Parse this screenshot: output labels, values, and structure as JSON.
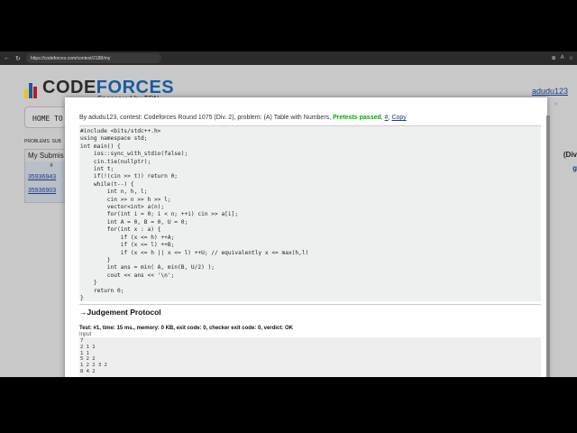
{
  "browser": {
    "url": "https://codeforces.com/contest/2188/my"
  },
  "site": {
    "logo_text_a": "CODE",
    "logo_text_b": "FORCES",
    "sponsor": "Sponsored by TON",
    "user": "adudu123",
    "menu_home": "HOME",
    "menu_more": "TO",
    "subnav_problems": "PROBLEMS",
    "subnav_sub": "SUB",
    "my_submissions": "My Submis",
    "col_hash": "#",
    "submissions": [
      "35936943",
      "35936903"
    ],
    "right_fragment": "(Div",
    "right_fragment2": "g"
  },
  "modal": {
    "info_prefix": "By adudu123, contest: Codeforces Round 1075 (Div. 2), problem: (A) Table with Numbers, ",
    "verdict": "Pretests passed",
    "sep1": ", ",
    "hash_link": "#",
    "sep2": ", ",
    "copy_link": "Copy",
    "close": "×",
    "code": [
      "#include <bits/stdc++.h>",
      "using namespace std;",
      "int main() {",
      "    ios::sync_with_stdio(false);",
      "    cin.tie(nullptr);",
      "    int t;",
      "    if(!(cin >> t)) return 0;",
      "    while(t--) {",
      "        int n, h, l;",
      "        cin >> n >> h >> l;",
      "        vector<int> a(n);",
      "        for(int i = 0; i < n; ++i) cin >> a[i];",
      "        int A = 0, B = 0, U = 0;",
      "        for(int x : a) {",
      "            if (x <= h) ++A;",
      "            if (x <= l) ++B;",
      "            if (x <= h || x <= l) ++U; // equivalently x <= max(h,l)",
      "        }",
      "        int ans = min( A, min(B, U/2) );",
      "        cout << ans << '\\n';",
      "    }",
      "    return 0;",
      "}"
    ],
    "protocol_title": "→Judgement Protocol",
    "test_line": "Test: #1, time: 15 ms., memory: 0 KB, exit code: 0, checker exit code: 0, verdict: OK",
    "input_label": "Input",
    "input_lines": [
      "7",
      "2 1 1",
      "1 1",
      "5 2 2",
      "1 2 2 3 2",
      "8 4 2"
    ]
  }
}
